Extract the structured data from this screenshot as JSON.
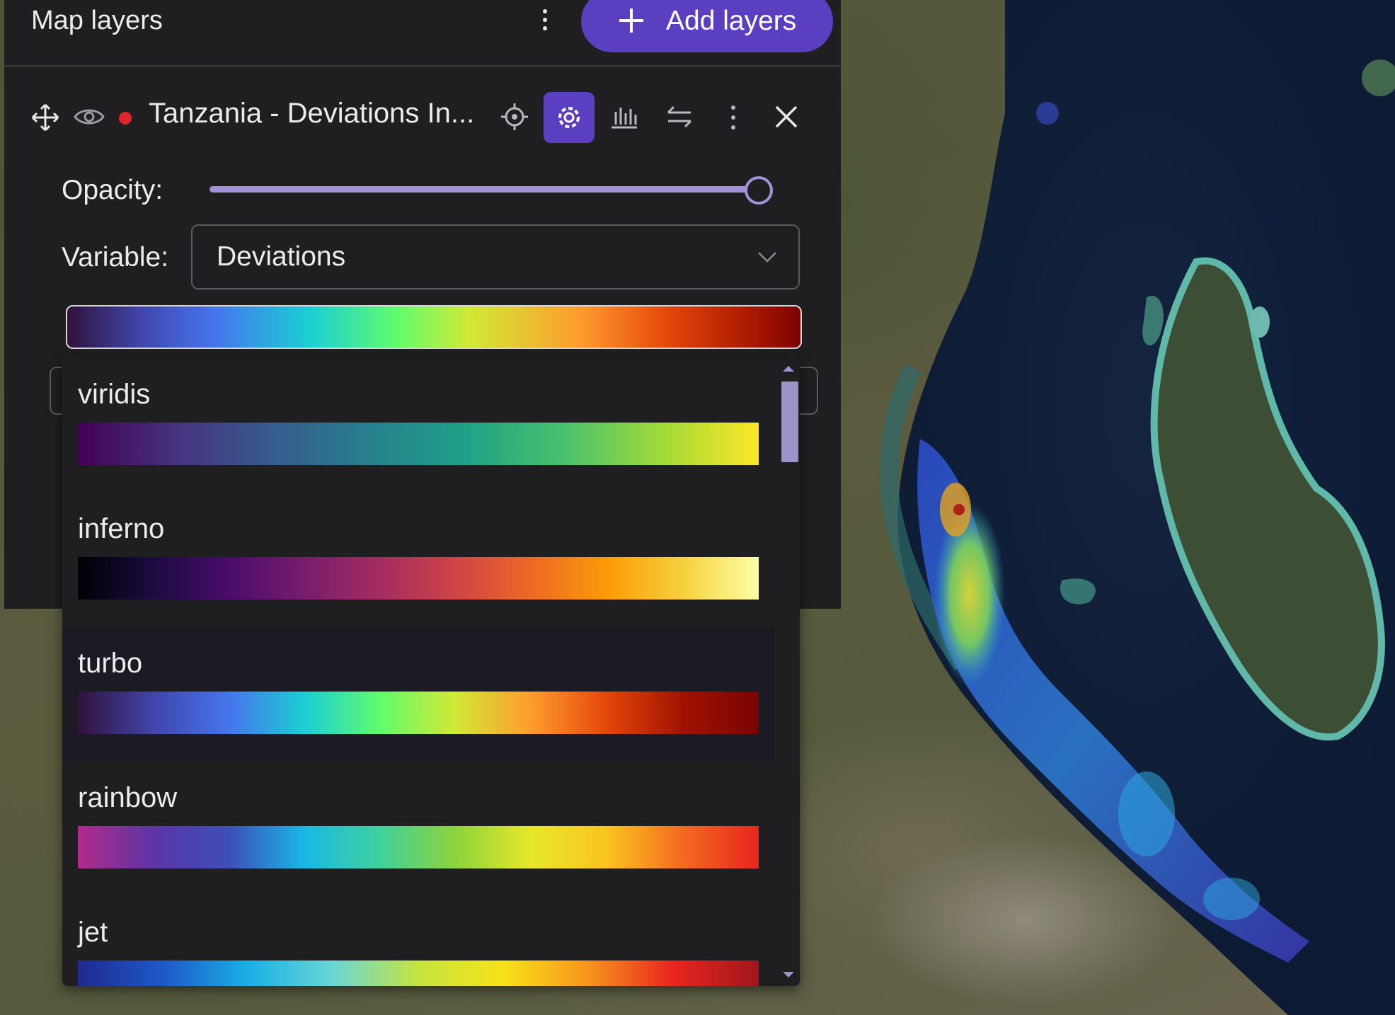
{
  "panel": {
    "title": "Map layers",
    "menu_icon": "more-vert-icon",
    "add_button_label": "Add layers",
    "add_icon": "plus-icon"
  },
  "layer": {
    "name": "Tanzania - Deviations In...",
    "status_color": "#e0242b",
    "icons": [
      "move-icon",
      "visibility-icon",
      "status-dot",
      "locate-icon",
      "settings-icon",
      "chart-icon",
      "compare-icon",
      "more-vert-icon",
      "close-icon"
    ]
  },
  "settings": {
    "opacity_label": "Opacity:",
    "opacity_value": 1.0,
    "variable_label": "Variable:",
    "variable_value": "Deviations",
    "current_colormap": "turbo"
  },
  "colormap_menu": {
    "items": [
      {
        "name": "viridis",
        "colors": [
          "#440154",
          "#46327e",
          "#365c8d",
          "#277f8e",
          "#1fa187",
          "#4ac16d",
          "#a0da39",
          "#fde725"
        ]
      },
      {
        "name": "inferno",
        "colors": [
          "#000004",
          "#1b0c41",
          "#4a0c6b",
          "#781c6d",
          "#a52c60",
          "#cf4446",
          "#ed6925",
          "#fb9b06",
          "#f7d13d",
          "#fcffa4"
        ]
      },
      {
        "name": "turbo",
        "colors": [
          "#30123b",
          "#4145ab",
          "#4675ed",
          "#1bcfd4",
          "#61fc6c",
          "#d2e935",
          "#fe9b2d",
          "#e4460a",
          "#a01200",
          "#7a0403"
        ]
      },
      {
        "name": "rainbow",
        "colors": [
          "#b22a8a",
          "#5b35a6",
          "#3d4fb8",
          "#1ab8e6",
          "#3fd29b",
          "#8ed33b",
          "#e8e82a",
          "#fbc31f",
          "#f46a1f",
          "#e8251f"
        ]
      },
      {
        "name": "jet",
        "colors": [
          "#1f2a8f",
          "#1e58c8",
          "#1ab0e6",
          "#6ad6d6",
          "#c6e43f",
          "#f8e21a",
          "#f7941d",
          "#e8251f",
          "#a1161b"
        ]
      }
    ],
    "active_index": 2
  }
}
